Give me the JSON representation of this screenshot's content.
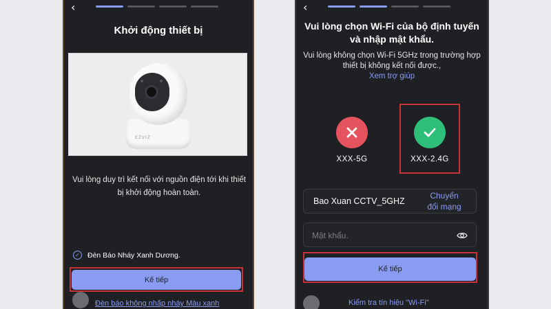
{
  "left_screen": {
    "back_icon": "chevron-left-icon",
    "progress_steps": 4,
    "progress_active": 1,
    "title": "Khởi động thiết bị",
    "device_image": "ezviz-camera",
    "camera_logo_text": "EZVIZ",
    "instruction": "Vui lòng duy trì kết nối với nguồn điện tới khi thiết bị khởi động hoàn toàn.",
    "checkbox_label": "Đèn Báo Nháy Xanh Dương.",
    "checkbox_checked": true,
    "next_button": "Kế tiếp",
    "bottom_link": "Đèn báo không nhấp nháy Màu xanh"
  },
  "right_screen": {
    "back_icon": "chevron-left-icon",
    "progress_steps": 4,
    "progress_active": 2,
    "title": "Vui lòng chọn Wi-Fi của bộ định tuyến và nhập mật khẩu.",
    "subtitle": "Vui lòng không chọn Wi-Fi 5GHz trong trường hợp thiết bị không kết nối được.,",
    "help_link": "Xem trợ giúp",
    "wifi_options": [
      {
        "label": "XXX-5G",
        "status": "invalid",
        "icon": "x-icon",
        "color": "#e5545e"
      },
      {
        "label": "XXX-2.4G",
        "status": "valid",
        "icon": "checkmark-icon",
        "color": "#2ebf7a"
      }
    ],
    "network_name": "Bao Xuan CCTV_5GHZ",
    "switch_network_link": "Chuyển đổi mạng",
    "password_placeholder": "Mật khẩu.",
    "password_value": "",
    "eye_icon": "eye-icon",
    "next_button": "Kế tiếp",
    "bottom_link": "Kiểm tra tín hiệu \"Wi-Fi\""
  },
  "colors": {
    "background": "#e9ebef",
    "screen": "#1f2024",
    "accent": "#8a9cf2",
    "highlight_border": "#c8333a"
  }
}
